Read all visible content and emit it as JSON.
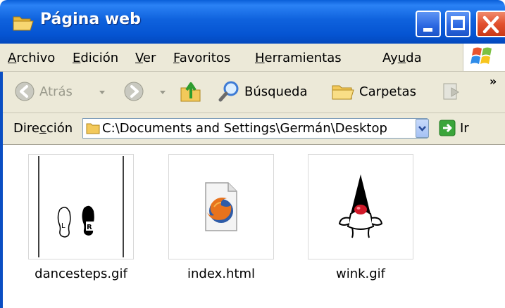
{
  "window": {
    "title": "Página web"
  },
  "menu": {
    "items": [
      {
        "pre": "",
        "u": "A",
        "post": "rchivo"
      },
      {
        "pre": "",
        "u": "E",
        "post": "dición"
      },
      {
        "pre": "",
        "u": "V",
        "post": "er"
      },
      {
        "pre": "",
        "u": "F",
        "post": "avoritos"
      },
      {
        "pre": "",
        "u": "H",
        "post": "erramientas"
      },
      {
        "pre": "Ay",
        "u": "u",
        "post": "da"
      }
    ]
  },
  "toolbar": {
    "back_label": "Atrás",
    "search_label": "Búsqueda",
    "folders_label": "Carpetas",
    "more": "»"
  },
  "address": {
    "label_pre": "Dire",
    "label_u": "c",
    "label_post": "ción",
    "path": "C:\\Documents and Settings\\Germán\\Desktop",
    "go_label": "Ir"
  },
  "files": [
    {
      "name": "dancesteps.gif",
      "icon": "dance-steps-icon"
    },
    {
      "name": "index.html",
      "icon": "firefox-html-icon"
    },
    {
      "name": "wink.gif",
      "icon": "duke-mascot-icon"
    }
  ],
  "colors": {
    "titlebar": "#0554d2",
    "chrome": "#ece9d8",
    "close": "#e2502e"
  }
}
